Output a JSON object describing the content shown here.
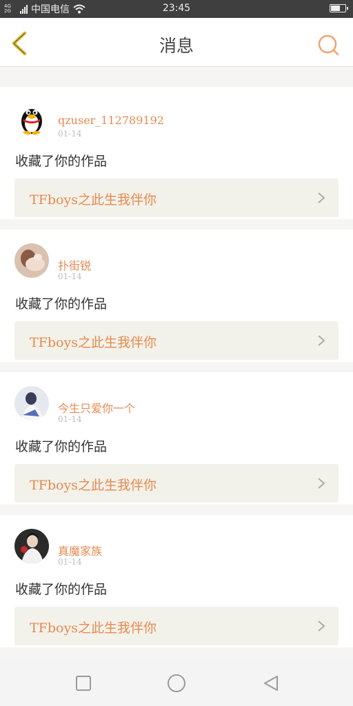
{
  "statusbar": {
    "network_label": "4G\n2G",
    "carrier": "中国电信",
    "time": "23:45",
    "battery_level": 0.6
  },
  "nav": {
    "title": "消息",
    "back_icon": "chevron-left-icon",
    "search_icon": "search-icon"
  },
  "messages": [
    {
      "user": "qzuser_112789192",
      "date": "01-14",
      "action": "收藏了你的作品",
      "work": "TFboys之此生我伴你",
      "avatar": "qq-penguin"
    },
    {
      "user": "扑街锐",
      "date": "01-14",
      "action": "收藏了你的作品",
      "work": "TFboys之此生我伴你",
      "avatar": "photo"
    },
    {
      "user": "今生只爱你一个",
      "date": "01-14",
      "action": "收藏了你的作品",
      "work": "TFboys之此生我伴你",
      "avatar": "photo"
    },
    {
      "user": "真魔家族",
      "date": "01-14",
      "action": "收藏了你的作品",
      "work": "TFboys之此生我伴你",
      "avatar": "photo"
    }
  ],
  "colors": {
    "accent": "#e8884f",
    "back_arrow": "#e4c74a",
    "work_bg": "#f3f2ea"
  },
  "system_nav": [
    "recents-square-icon",
    "home-circle-icon",
    "back-triangle-icon"
  ]
}
